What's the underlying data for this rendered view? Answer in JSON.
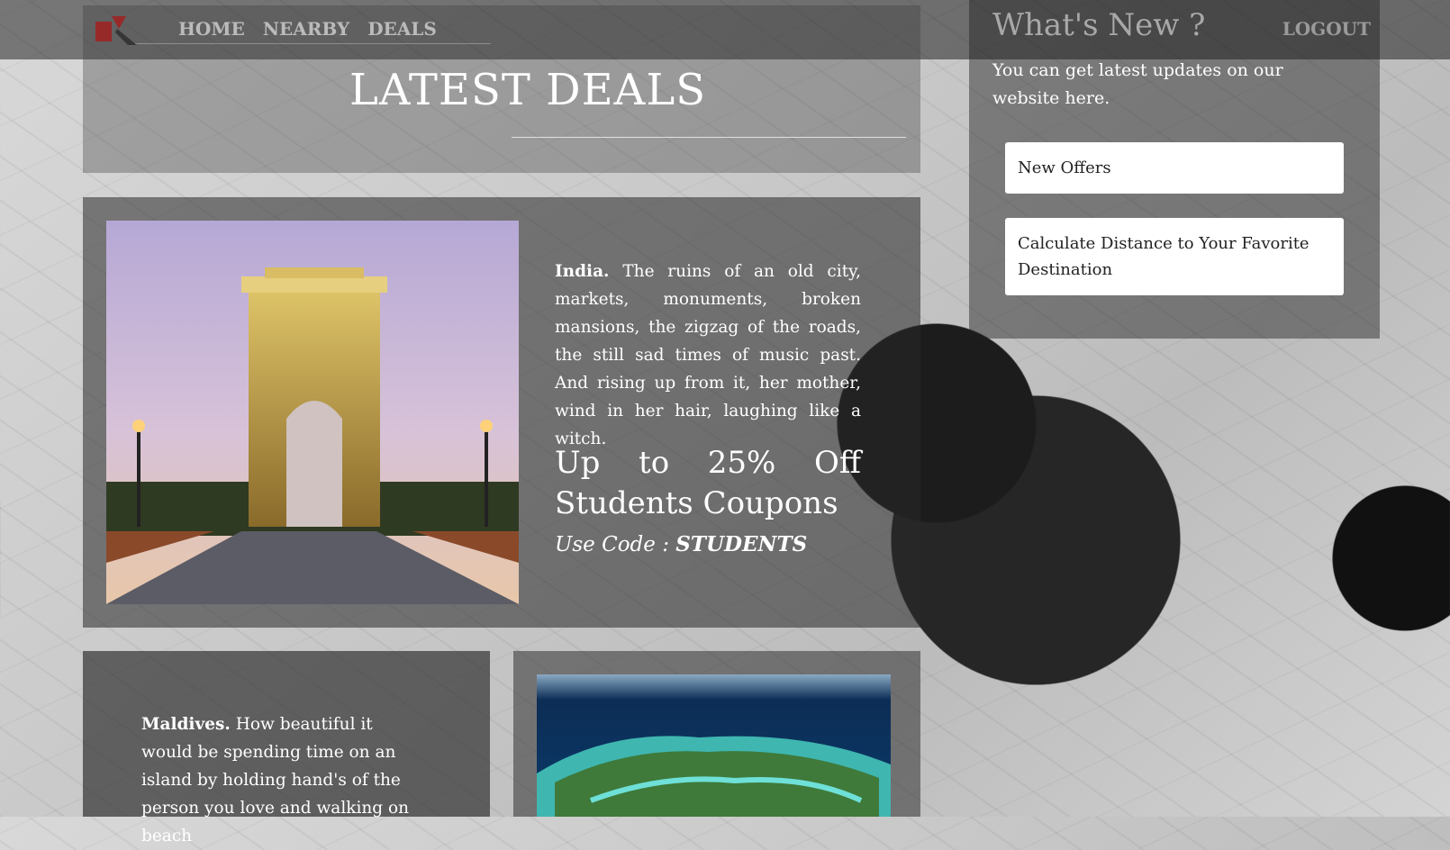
{
  "nav": {
    "items": [
      "HOME",
      "NEARBY",
      "DEALS"
    ],
    "logout": "LOGOUT"
  },
  "deals": {
    "title": "LATEST DEALS"
  },
  "feature": {
    "place": "India.",
    "description": "The ruins of an old city, markets, monuments, broken mansions, the zigzag of the roads, the still sad times of music past. And rising up from it, her mother, wind in her hair, laughing like a witch.",
    "discount_line1": "Up to 25% Off",
    "discount_line2": "Students Coupons",
    "coupon_prefix": "Use Code :",
    "coupon_code": "STUDENTS"
  },
  "whats_new": {
    "title": "What's New ?",
    "text": "You can get latest updates on our website here.",
    "links": [
      "New Offers",
      "Calculate Distance to Your Favorite Destination"
    ]
  },
  "second_deal": {
    "place": "Maldives.",
    "description": "How beautiful it would be spending time on an island by holding hand's of the person you love and walking on beach"
  },
  "colors": {
    "overlay": "#000000",
    "text": "#ffffff",
    "brand_red": "#d42a2a"
  }
}
